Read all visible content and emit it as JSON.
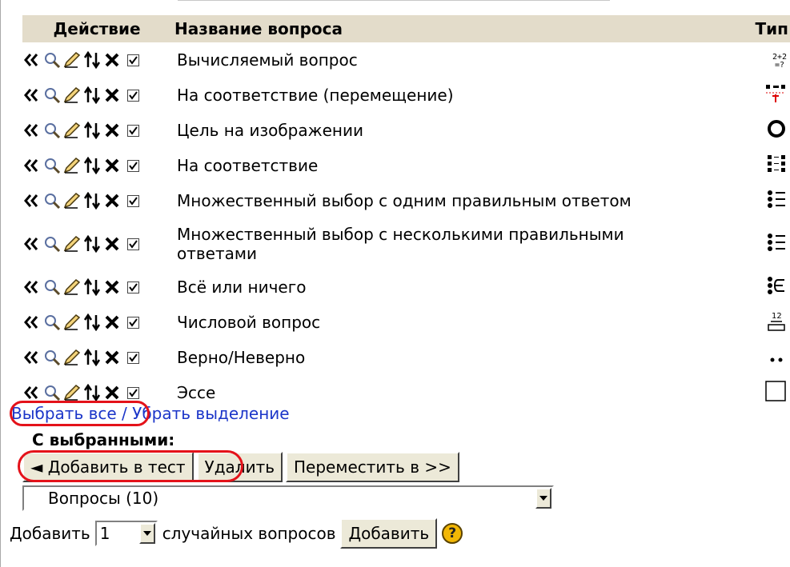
{
  "table": {
    "headers": {
      "action": "Действие",
      "name": "Название вопроса",
      "type": "Тип"
    },
    "row_actions": [
      "move-to-quiz-icon",
      "preview-icon",
      "edit-icon",
      "move-icon",
      "delete-icon"
    ],
    "rows": [
      {
        "name": "Вычисляемый вопрос",
        "checked": true,
        "type_icon": "calculated-type-icon",
        "type_text": "2+2\n=?"
      },
      {
        "name": "На соответствие (перемещение)",
        "checked": true,
        "type_icon": "drag-match-type-icon"
      },
      {
        "name": "Цель на изображении",
        "checked": true,
        "type_icon": "image-target-type-icon"
      },
      {
        "name": "На соответствие",
        "checked": true,
        "type_icon": "matching-type-icon"
      },
      {
        "name": "Множественный выбор с одним правильным ответом",
        "checked": true,
        "type_icon": "multichoice-single-type-icon"
      },
      {
        "name": "Множественный выбор с несколькими правильными ответами",
        "checked": true,
        "type_icon": "multichoice-multi-type-icon"
      },
      {
        "name": "Всё или ничего",
        "checked": true,
        "type_icon": "all-or-nothing-type-icon"
      },
      {
        "name": "Числовой вопрос",
        "checked": true,
        "type_icon": "numerical-type-icon",
        "type_text": "12"
      },
      {
        "name": "Верно/Неверно",
        "checked": true,
        "type_icon": "truefalse-type-icon"
      },
      {
        "name": "Эссе",
        "checked": true,
        "type_icon": "essay-type-icon"
      }
    ]
  },
  "selection": {
    "select_all": "Выбрать все",
    "separator": "/",
    "deselect": "Убрать выделение"
  },
  "with_selected": {
    "label": "С выбранными:",
    "add_to_quiz": "◄ Добавить в тест",
    "delete": "Удалить",
    "move_to": "Переместить в >>"
  },
  "category_select": {
    "value": "Вопросы (10)"
  },
  "random": {
    "prefix": "Добавить",
    "count": "1",
    "suffix": "случайных вопросов",
    "button": "Добавить",
    "help": "?"
  },
  "colors": {
    "header_bg": "#e3dcca",
    "link": "#1c36c9",
    "highlight": "#e4121a",
    "button_bg": "#ece9d8"
  }
}
